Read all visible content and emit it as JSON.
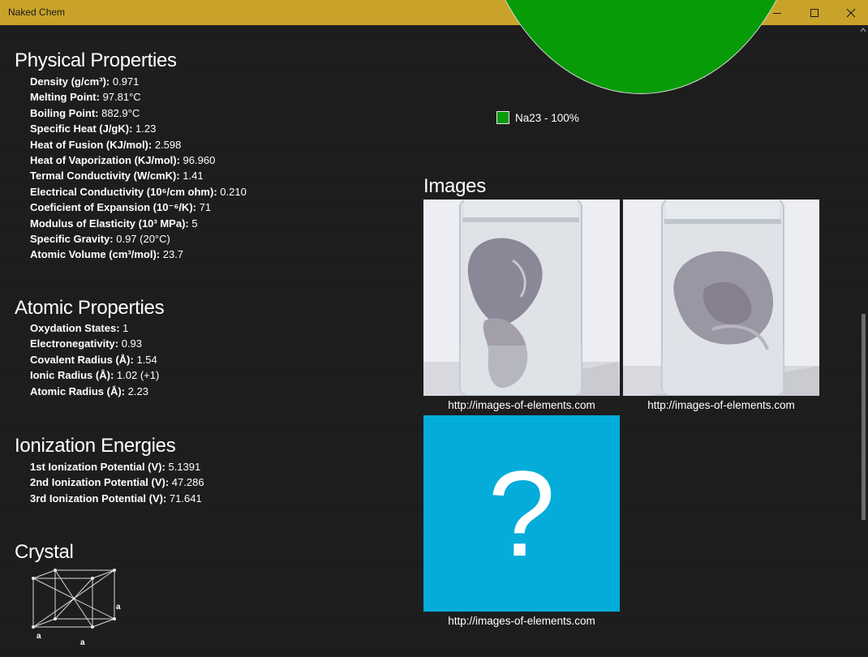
{
  "window": {
    "title": "Naked Chem",
    "minimize_glyph": "—",
    "maximize_glyph": "☐",
    "close_glyph": "✕"
  },
  "physical": {
    "title": "Physical Properties",
    "items": [
      {
        "label": "Density (g/cm³):",
        "value": "0.971"
      },
      {
        "label": "Melting Point:",
        "value": "97.81°C"
      },
      {
        "label": "Boiling Point:",
        "value": "882.9°C"
      },
      {
        "label": "Specific Heat (J/gK):",
        "value": "1.23"
      },
      {
        "label": "Heat of Fusion (KJ/mol):",
        "value": "2.598"
      },
      {
        "label": "Heat of Vaporization (KJ/mol):",
        "value": "96.960"
      },
      {
        "label": "Termal Conductivity (W/cmK):",
        "value": "1.41"
      },
      {
        "label": "Electrical Conductivity (10⁶/cm ohm):",
        "value": "0.210"
      },
      {
        "label": "Coeficient of Expansion (10⁻⁶/K):",
        "value": "71"
      },
      {
        "label": "Modulus of Elasticity (10³ MPa):",
        "value": "5"
      },
      {
        "label": "Specific Gravity:",
        "value": "0.97 (20°C)"
      },
      {
        "label": "Atomic Volume (cm³/mol):",
        "value": "23.7"
      }
    ]
  },
  "atomic": {
    "title": "Atomic Properties",
    "items": [
      {
        "label": "Oxydation States:",
        "value": "1"
      },
      {
        "label": "Electronegativity:",
        "value": "0.93"
      },
      {
        "label": "Covalent Radius (Å):",
        "value": "1.54"
      },
      {
        "label": "Ionic Radius (Å):",
        "value": "1.02 (+1)"
      },
      {
        "label": "Atomic Radius (Å):",
        "value": "2.23"
      }
    ]
  },
  "ionization": {
    "title": "Ionization Energies",
    "items": [
      {
        "label": "1st Ionization Potential (V):",
        "value": "5.1391"
      },
      {
        "label": "2nd Ionization Potential (V):",
        "value": "47.286"
      },
      {
        "label": "3rd Ionization Potential (V):",
        "value": "71.641"
      }
    ]
  },
  "crystal": {
    "title": "Crystal",
    "edge_label_right": "a",
    "edge_label_left": "a",
    "edge_label_bottom": "a"
  },
  "isotopes": {
    "legend": [
      {
        "label": "Na23 - 100%",
        "percent": 100,
        "color": "#079b07"
      }
    ]
  },
  "images": {
    "title": "Images",
    "items": [
      {
        "caption": "http://images-of-elements.com",
        "icon": "sodium-sample-photo"
      },
      {
        "caption": "http://images-of-elements.com",
        "icon": "sodium-sample-photo"
      },
      {
        "caption": "http://images-of-elements.com",
        "icon": "question-mark-icon",
        "glyph": "?"
      }
    ]
  },
  "colors": {
    "titlebar": "#c9a22a",
    "background": "#1c1c1c",
    "isotope_green": "#079b07",
    "placeholder_blue": "#03acd9"
  }
}
